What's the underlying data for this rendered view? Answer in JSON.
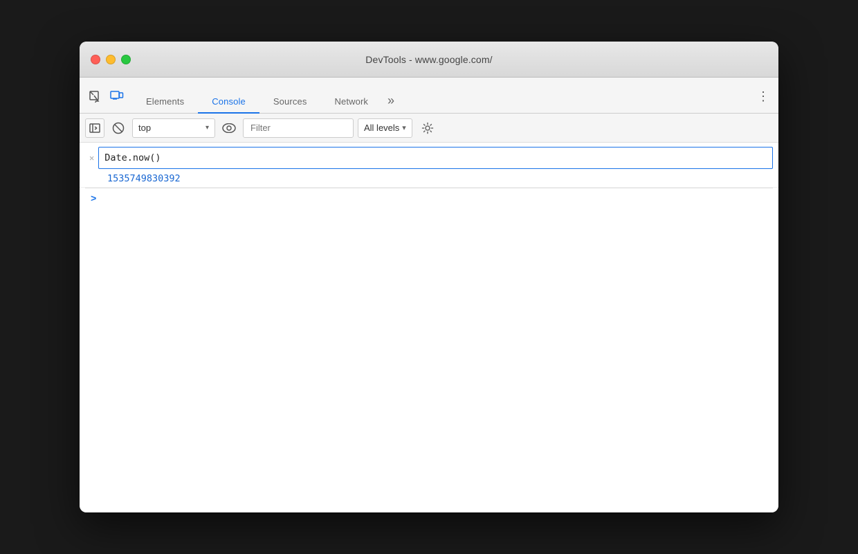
{
  "window": {
    "title": "DevTools - www.google.com/"
  },
  "traffic_lights": {
    "close_label": "close",
    "minimize_label": "minimize",
    "maximize_label": "maximize"
  },
  "tabs": {
    "items": [
      {
        "id": "elements",
        "label": "Elements",
        "active": false
      },
      {
        "id": "console",
        "label": "Console",
        "active": true
      },
      {
        "id": "sources",
        "label": "Sources",
        "active": false
      },
      {
        "id": "network",
        "label": "Network",
        "active": false
      }
    ],
    "more_label": "»",
    "menu_label": "⋮"
  },
  "toolbar": {
    "context_value": "top",
    "filter_placeholder": "Filter",
    "levels_label": "All levels",
    "icons": {
      "sidebar": "▶",
      "block": "🚫",
      "eye": "👁",
      "chevron_down": "▾",
      "gear": "⚙"
    }
  },
  "console": {
    "input_text": "Date.now()",
    "result_value": "1535749830392",
    "prompt_symbol": ">"
  },
  "colors": {
    "active_tab": "#1a73e8",
    "result_blue": "#1967d2",
    "border_blue": "#1a73e8"
  }
}
